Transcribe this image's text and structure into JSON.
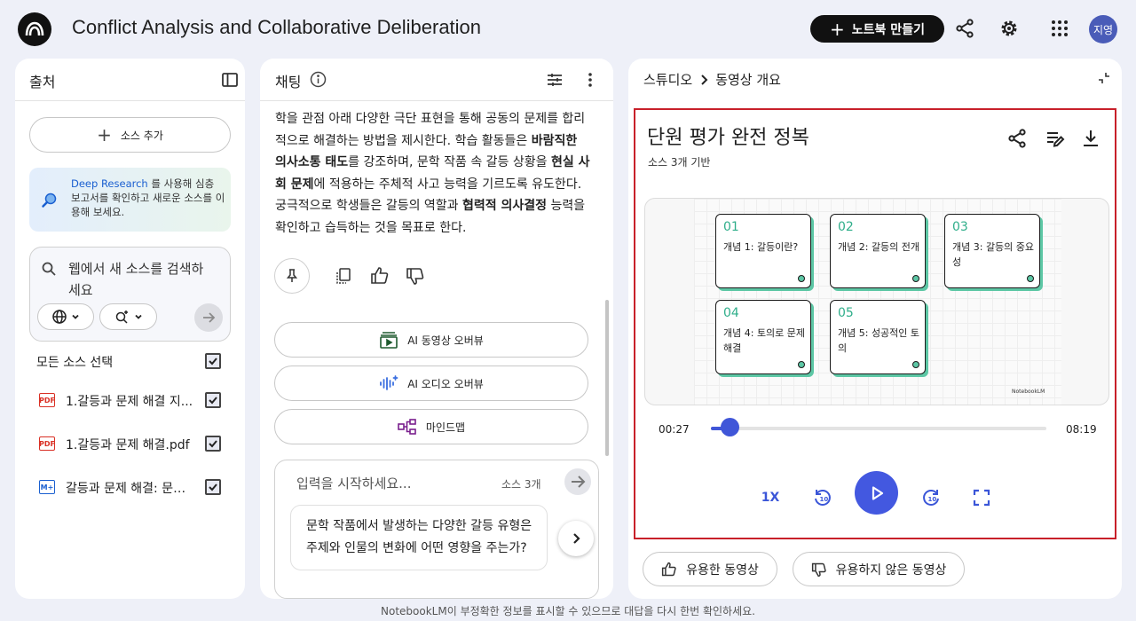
{
  "header": {
    "title": "Conflict Analysis and Collaborative Deliberation",
    "create_label": "노트북 만들기",
    "avatar": "지영"
  },
  "sources": {
    "title": "출처",
    "add_label": "소스 추가",
    "deep_research_link": "Deep Research",
    "deep_research_rest": " 를 사용해 심층 보고서를 확인하고 새로운 소스를 이용해 보세요.",
    "search_placeholder": "웹에서 새 소스를 검색하세요",
    "select_all": "모든 소스 선택",
    "items": [
      {
        "type": "PDF",
        "label": "1.갈등과 문제 해결 지..."
      },
      {
        "type": "PDF",
        "label": "1.갈등과 문제 해결.pdf"
      },
      {
        "type": "M+",
        "label": "갈등과 문제 해결: 문학..."
      }
    ]
  },
  "chat": {
    "title": "채팅",
    "paragraph": [
      {
        "t": "학을 관점 아래 다양한 극단 표현을 통해 공동의 문제를 합리"
      },
      {
        "t": "적으로 해결하는 방법을 제시한다. 학습 활동들은 "
      },
      {
        "t": "바람직한 의사소통 태도",
        "b": true
      },
      {
        "t": "를 강조하며, 문학 작품 속 갈등 상황을 "
      },
      {
        "t": "현실 사회 문제",
        "b": true
      },
      {
        "t": "에 적용하는 주체적 사고 능력을 기르도록 유도한다. 궁극적으로 학생들은 갈등의 역할과 "
      },
      {
        "t": "협력적 의사결정",
        "b": true
      },
      {
        "t": " 능력을 확인하고 습득하는 것을 목표로 한다."
      }
    ],
    "actions": {
      "video": "AI 동영상 오버뷰",
      "audio": "AI 오디오 오버뷰",
      "mindmap": "마인드맵"
    },
    "input_placeholder": "입력을 시작하세요...",
    "source_count": "소스 3개",
    "suggestion": "문학 작품에서 발생하는 다양한 갈등 유형은 주제와 인물의 변화에 어떤 영향을 주는가?"
  },
  "studio": {
    "crumb_root": "스튜디오",
    "crumb_current": "동영상 개요",
    "video_title": "단원 평가 완전 정복",
    "video_subtitle": "소스 3개 기반",
    "cards": [
      {
        "num": "01",
        "label": "개념 1: 갈등이란?"
      },
      {
        "num": "02",
        "label": "개념 2: 갈등의 전개"
      },
      {
        "num": "03",
        "label": "개념 3: 갈등의 중요성"
      },
      {
        "num": "04",
        "label": "개념 4: 토의로 문제 해결"
      },
      {
        "num": "05",
        "label": "개념 5: 성공적인 토의"
      }
    ],
    "brand": "NotebookLM",
    "time_current": "00:27",
    "time_total": "08:19",
    "progress": 0.055,
    "speed": "1X",
    "helpful": "유용한 동영상",
    "not_helpful": "유용하지 않은 동영상"
  },
  "footer": "NotebookLM이 부정확한 정보를 표시할 수 있으므로 대답을 다시 한번 확인하세요."
}
